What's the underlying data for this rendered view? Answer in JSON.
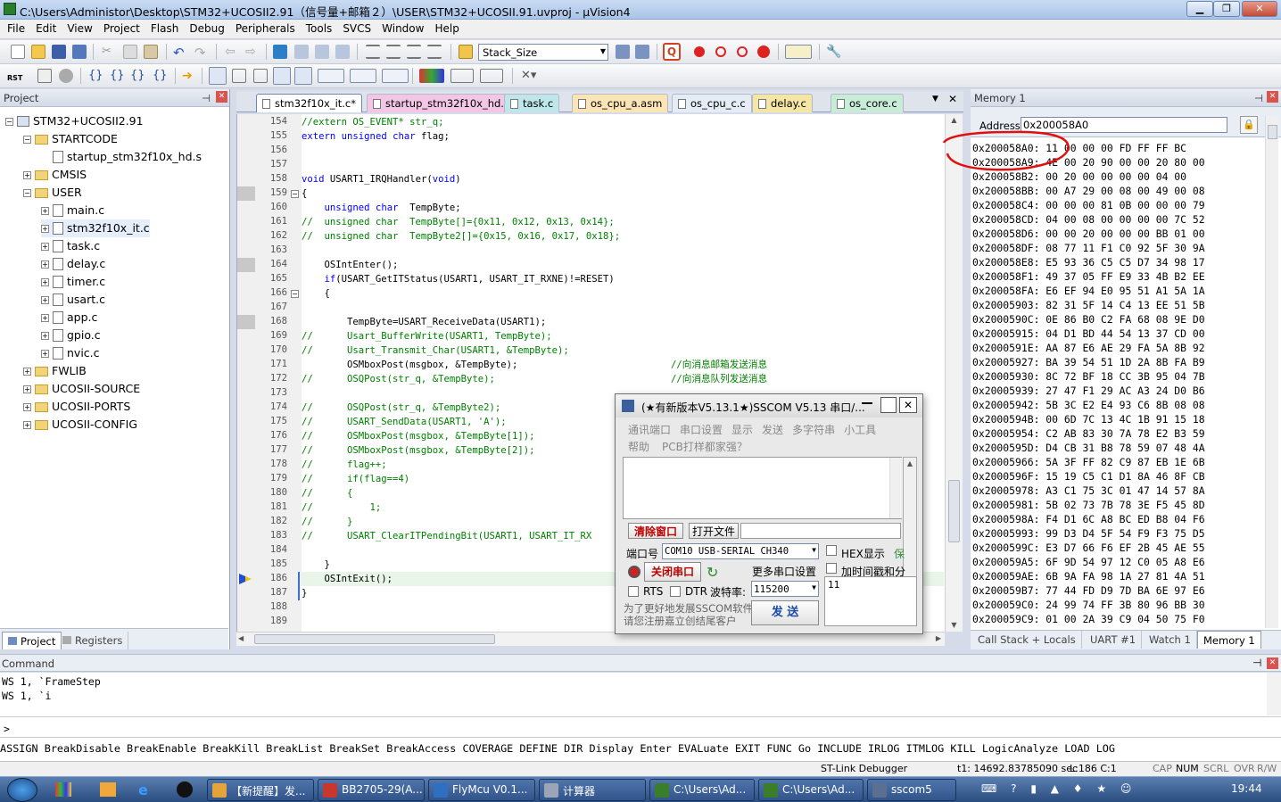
{
  "window": {
    "title": "C:\\Users\\Administor\\Desktop\\STM32+UCOSII2.91（信号量+邮箱２）\\USER\\STM32+UCOSII.91.uvproj - µVision4",
    "min": "▁",
    "max": "❐",
    "close": "✕"
  },
  "menu": [
    "File",
    "Edit",
    "View",
    "Project",
    "Flash",
    "Debug",
    "Peripherals",
    "Tools",
    "SVCS",
    "Window",
    "Help"
  ],
  "toolbar": {
    "target_combo": "Stack_Size",
    "rst": "RST"
  },
  "project": {
    "title": "Project",
    "pin": "ᵖ",
    "close": "✕",
    "root": "STM32+UCOSII2.91",
    "items": [
      {
        "label": "STARTCODE",
        "kind": "folder",
        "level": 1,
        "exp": "−"
      },
      {
        "label": "startup_stm32f10x_hd.s",
        "kind": "file",
        "level": 2,
        "exp": ""
      },
      {
        "label": "CMSIS",
        "kind": "folder",
        "level": 1,
        "exp": "+"
      },
      {
        "label": "USER",
        "kind": "folder",
        "level": 1,
        "exp": "−"
      },
      {
        "label": "main.c",
        "kind": "file",
        "level": 2,
        "exp": "+"
      },
      {
        "label": "stm32f10x_it.c",
        "kind": "file",
        "level": 2,
        "exp": "+"
      },
      {
        "label": "task.c",
        "kind": "file",
        "level": 2,
        "exp": "+"
      },
      {
        "label": "delay.c",
        "kind": "file",
        "level": 2,
        "exp": "+"
      },
      {
        "label": "timer.c",
        "kind": "file",
        "level": 2,
        "exp": "+"
      },
      {
        "label": "usart.c",
        "kind": "file",
        "level": 2,
        "exp": "+"
      },
      {
        "label": "app.c",
        "kind": "file",
        "level": 2,
        "exp": "+"
      },
      {
        "label": "gpio.c",
        "kind": "file",
        "level": 2,
        "exp": "+"
      },
      {
        "label": "nvic.c",
        "kind": "file",
        "level": 2,
        "exp": "+"
      },
      {
        "label": "FWLIB",
        "kind": "folder",
        "level": 1,
        "exp": "+"
      },
      {
        "label": "UCOSII-SOURCE",
        "kind": "folder",
        "level": 1,
        "exp": "+"
      },
      {
        "label": "UCOSII-PORTS",
        "kind": "folder",
        "level": 1,
        "exp": "+"
      },
      {
        "label": "UCOSII-CONFIG",
        "kind": "folder",
        "level": 1,
        "exp": "+"
      }
    ],
    "tabs": [
      "Project",
      "Registers"
    ]
  },
  "editor": {
    "tabs": [
      {
        "label": "stm32f10x_it.c*",
        "color": "#f6e6a6",
        "active": true
      },
      {
        "label": "startup_stm32f10x_hd.s",
        "color": "#f3c6e6"
      },
      {
        "label": "task.c",
        "color": "#bfe6ea"
      },
      {
        "label": "os_cpu_a.asm",
        "color": "#fbe5b7"
      },
      {
        "label": "os_cpu_c.c",
        "color": "#e6ecf6"
      },
      {
        "label": "delay.c",
        "color": "#f6e6a6"
      },
      {
        "label": "os_core.c",
        "color": "#c9ecd8"
      }
    ],
    "lines": [
      {
        "n": "154",
        "t": "//extern OS_EVENT* str_q;",
        "c": "cm"
      },
      {
        "n": "155",
        "t": "extern unsigned char flag;",
        "c": "kwline"
      },
      {
        "n": "156",
        "t": "",
        "c": ""
      },
      {
        "n": "157",
        "t": "",
        "c": ""
      },
      {
        "n": "158",
        "t": "void USART1_IRQHandler(void)",
        "c": "kwvoid"
      },
      {
        "n": "159",
        "t": "{",
        "c": "",
        "fold": "⊟"
      },
      {
        "n": "160",
        "t": "    unsigned char  TempByte;",
        "c": "kwuc"
      },
      {
        "n": "161",
        "t": "//  unsigned char  TempByte[]={0x11, 0x12, 0x13, 0x14};",
        "c": "cm"
      },
      {
        "n": "162",
        "t": "//  unsigned char  TempByte2[]={0x15, 0x16, 0x17, 0x18};",
        "c": "cm"
      },
      {
        "n": "163",
        "t": "",
        "c": ""
      },
      {
        "n": "164",
        "t": "    OSIntEnter();",
        "c": ""
      },
      {
        "n": "165",
        "t": "    if(USART_GetITStatus(USART1, USART_IT_RXNE)!=RESET)",
        "c": "kwif"
      },
      {
        "n": "166",
        "t": "    {",
        "c": "",
        "fold": "⊟"
      },
      {
        "n": "167",
        "t": "",
        "c": ""
      },
      {
        "n": "168",
        "t": "        TempByte=USART_ReceiveData(USART1);",
        "c": ""
      },
      {
        "n": "169",
        "t": "//      Usart_BufferWrite(USART1, TempByte);",
        "c": "cm"
      },
      {
        "n": "170",
        "t": "//      Usart_Transmit_Char(USART1, &TempByte);",
        "c": "cm"
      },
      {
        "n": "171",
        "t": "        OSMboxPost(msgbox, &TempByte);",
        "c": "",
        "tail": "//向消息邮箱发送消息"
      },
      {
        "n": "172",
        "t": "//      OSQPost(str_q, &TempByte);",
        "c": "cm",
        "tail": "//向消息队列发送消息"
      },
      {
        "n": "173",
        "t": "",
        "c": ""
      },
      {
        "n": "174",
        "t": "//      OSQPost(str_q, &TempByte2);",
        "c": "cm"
      },
      {
        "n": "175",
        "t": "//      USART_SendData(USART1, 'A');",
        "c": "cm"
      },
      {
        "n": "176",
        "t": "//      OSMboxPost(msgbox, &TempByte[1]);",
        "c": "cm"
      },
      {
        "n": "177",
        "t": "//      OSMboxPost(msgbox, &TempByte[2]);",
        "c": "cm"
      },
      {
        "n": "178",
        "t": "//      flag++;",
        "c": "cm"
      },
      {
        "n": "179",
        "t": "//      if(flag==4)",
        "c": "cm"
      },
      {
        "n": "180",
        "t": "//      {",
        "c": "cm"
      },
      {
        "n": "181",
        "t": "//          1;",
        "c": "cm"
      },
      {
        "n": "182",
        "t": "//      }",
        "c": "cm"
      },
      {
        "n": "183",
        "t": "//      USART_ClearITPendingBit(USART1, USART_IT_RX",
        "c": "cm"
      },
      {
        "n": "184",
        "t": "",
        "c": ""
      },
      {
        "n": "185",
        "t": "    }",
        "c": ""
      },
      {
        "n": "186",
        "t": "    OSIntExit();",
        "c": ""
      },
      {
        "n": "187",
        "t": "}",
        "c": ""
      },
      {
        "n": "188",
        "t": "",
        "c": ""
      },
      {
        "n": "189",
        "t": "",
        "c": ""
      }
    ]
  },
  "memory": {
    "title": "Memory 1",
    "address_label": "Address:",
    "address_value": "0x200058A0",
    "rows": [
      "0x200058A0: 11 00 00 00 FD FF FF BC",
      "0x200058A9: 4E 00 20 90 00 00 20 80 00",
      "0x200058B2: 00 20 00 00 00 00 04 00",
      "0x200058BB: 00 A7 29 00 08 00 49 00 08",
      "0x200058C4: 00 00 00 81 0B 00 00 00 79",
      "0x200058CD: 04 00 08 00 00 00 00 7C 52",
      "0x200058D6: 00 00 20 00 00 00 BB 01 00",
      "0x200058DF: 08 77 11 F1 C0 92 5F 30 9A",
      "0x200058E8: E5 93 36 C5 C5 D7 34 98 17",
      "0x200058F1: 49 37 05 FF E9 33 4B B2 EE",
      "0x200058FA: E6 EF 94 E0 95 51 A1 5A 1A",
      "0x20005903: 82 31 5F 14 C4 13 EE 51 5B",
      "0x2000590C: 0E 86 B0 C2 FA 68 08 9E D0",
      "0x20005915: 04 D1 BD 44 54 13 37 CD 00",
      "0x2000591E: AA 87 E6 AE 29 FA 5A 8B 92",
      "0x20005927: BA 39 54 51 1D 2A 8B FA B9",
      "0x20005930: 8C 72 BF 18 CC 3B 95 04 7B",
      "0x20005939: 27 47 F1 29 AC A3 24 D0 B6",
      "0x20005942: 5B 3C E2 E4 93 C6 8B 08 08",
      "0x2000594B: 00 6D 7C 13 4C 1B 91 15 18",
      "0x20005954: C2 AB 83 30 7A 78 E2 B3 59",
      "0x2000595D: D4 CB 31 B8 78 59 07 48 4A",
      "0x20005966: 5A 3F FF 82 C9 87 EB 1E 6B",
      "0x2000596F: 15 19 C5 C1 D1 8A 46 8F CB",
      "0x20005978: A3 C1 75 3C 01 47 14 57 8A",
      "0x20005981: 5B 02 73 7B 78 3E F5 45 8D",
      "0x2000598A: F4 D1 6C A8 BC ED B8 04 F6",
      "0x20005993: 99 D3 D4 5F 54 F9 F3 75 D5",
      "0x2000599C: E3 D7 66 F6 EF 2B 45 AE 55",
      "0x200059A5: 6F 9D 54 97 12 C0 05 A8 E6",
      "0x200059AE: 6B 9A FA 98 1A 27 81 4A 51",
      "0x200059B7: 77 44 FD D9 7D BA 6E 97 E6",
      "0x200059C0: 24 99 74 FF 3B 80 96 BB 30",
      "0x200059C9: 01 00 2A 39 C9 04 50 75 F0"
    ],
    "tabs": [
      "Call Stack + Locals",
      "UART #1",
      "Watch 1",
      "Memory 1"
    ]
  },
  "command": {
    "title": "Command",
    "lines": [
      "WS 1, `FrameStep",
      "WS 1, `i"
    ],
    "prompt": ">",
    "keywords": "ASSIGN BreakDisable BreakEnable BreakKill BreakList BreakSet BreakAccess COVERAGE DEFINE DIR Display Enter EVALuate EXIT FUNC Go INCLUDE IRLOG ITMLOG KILL LogicAnalyze LOAD LOG"
  },
  "status": {
    "debugger": "ST-Link Debugger",
    "time": "t1: 14692.83785090 sec",
    "pos": "L:186 C:1",
    "caps": "CAP",
    "num": "NUM",
    "scrl": "SCRL",
    "ovr": "OVR",
    "rw": "R/W"
  },
  "sscom": {
    "title": "(★有新版本V5.13.1★)SSCOM V5.13 串口/...",
    "menu": [
      "通讯端口",
      "串口设置",
      "显示",
      "发送",
      "多字符串",
      "小工具"
    ],
    "menu2": [
      "帮助",
      "PCB打样都家强？"
    ],
    "clear_btn": "清除窗口",
    "open_file_btn": "打开文件",
    "port_label": "端口号",
    "port_value": "COM10 USB-SERIAL CH340",
    "hex_display": "HEX显示",
    "timestamp": "加时间戳和分",
    "close_port_btn": "关闭串口",
    "more_settings": "更多串口设置",
    "rts": "RTS",
    "dtr": "DTR",
    "baud_label": "波特率:",
    "baud_value": "115200",
    "send_text": "11",
    "send_btn": "发 送",
    "footer1": "为了更好地发展SSCOM软件",
    "footer2": "请您注册嘉立创结尾客户",
    "save_tab": "保"
  },
  "taskbar": {
    "items": [
      {
        "label": "【新提醒】发...",
        "color": "#e4a43a"
      },
      {
        "label": "BB2705-29(A...",
        "color": "#c8372d"
      },
      {
        "label": "FlyMcu V0.1...",
        "color": "#2f6fc2"
      },
      {
        "label": "计算器",
        "color": "#9aa6b5"
      },
      {
        "label": "C:\\Users\\Ad...",
        "color": "#3a7d2a"
      },
      {
        "label": "C:\\Users\\Ad...",
        "color": "#3a7d2a"
      },
      {
        "label": "sscom5",
        "color": "#5b6f8f"
      }
    ],
    "clock": "19:44"
  }
}
